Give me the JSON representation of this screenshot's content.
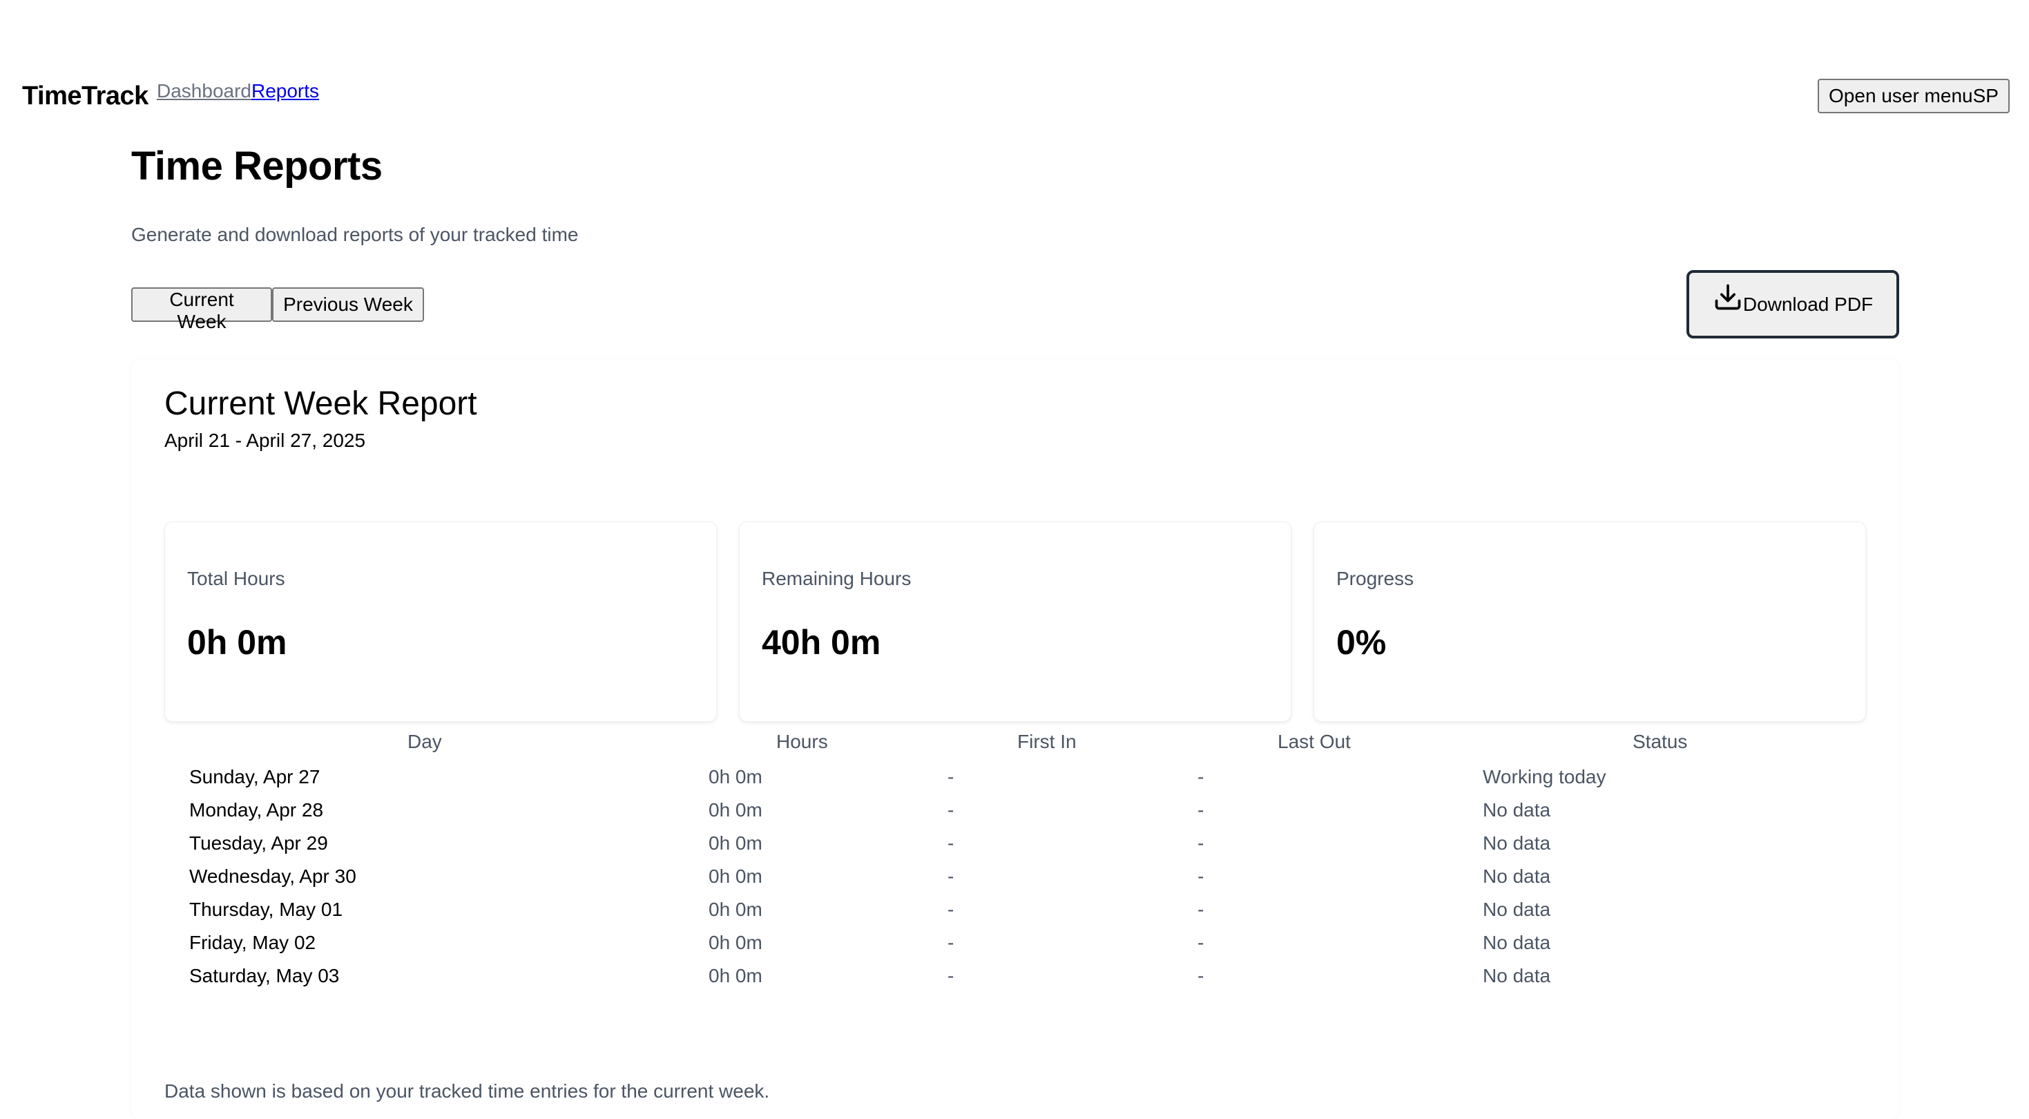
{
  "nav": {
    "brand": "TimeTrack",
    "links": [
      "Dashboard",
      "Reports"
    ],
    "user_menu_label": "Open user menu",
    "user_initials": "SP"
  },
  "header": {
    "title": "Time Reports",
    "subtitle": "Generate and download reports of your tracked time"
  },
  "controls": {
    "current_week_label": "Current Week",
    "previous_week_label": "Previous Week",
    "download_label": "Download PDF",
    "download_icon": "download-icon"
  },
  "report": {
    "title": "Current Week Report",
    "range": "April 21 - April 27, 2025",
    "stats": [
      {
        "label": "Total Hours",
        "value": "0h 0m"
      },
      {
        "label": "Remaining Hours",
        "value": "40h 0m"
      },
      {
        "label": "Progress",
        "value": "0%"
      }
    ],
    "columns": [
      "Day",
      "Hours",
      "First In",
      "Last Out",
      "Status"
    ],
    "rows": [
      {
        "day": "Sunday, Apr 27",
        "hours": "0h 0m",
        "first_in": "-",
        "last_out": "-",
        "status": "Working today"
      },
      {
        "day": "Monday, Apr 28",
        "hours": "0h 0m",
        "first_in": "-",
        "last_out": "-",
        "status": "No data"
      },
      {
        "day": "Tuesday, Apr 29",
        "hours": "0h 0m",
        "first_in": "-",
        "last_out": "-",
        "status": "No data"
      },
      {
        "day": "Wednesday, Apr 30",
        "hours": "0h 0m",
        "first_in": "-",
        "last_out": "-",
        "status": "No data"
      },
      {
        "day": "Thursday, May 01",
        "hours": "0h 0m",
        "first_in": "-",
        "last_out": "-",
        "status": "No data"
      },
      {
        "day": "Friday, May 02",
        "hours": "0h 0m",
        "first_in": "-",
        "last_out": "-",
        "status": "No data"
      },
      {
        "day": "Saturday, May 03",
        "hours": "0h 0m",
        "first_in": "-",
        "last_out": "-",
        "status": "No data"
      }
    ],
    "footnote": "Data shown is based on your tracked time entries for the current week."
  }
}
